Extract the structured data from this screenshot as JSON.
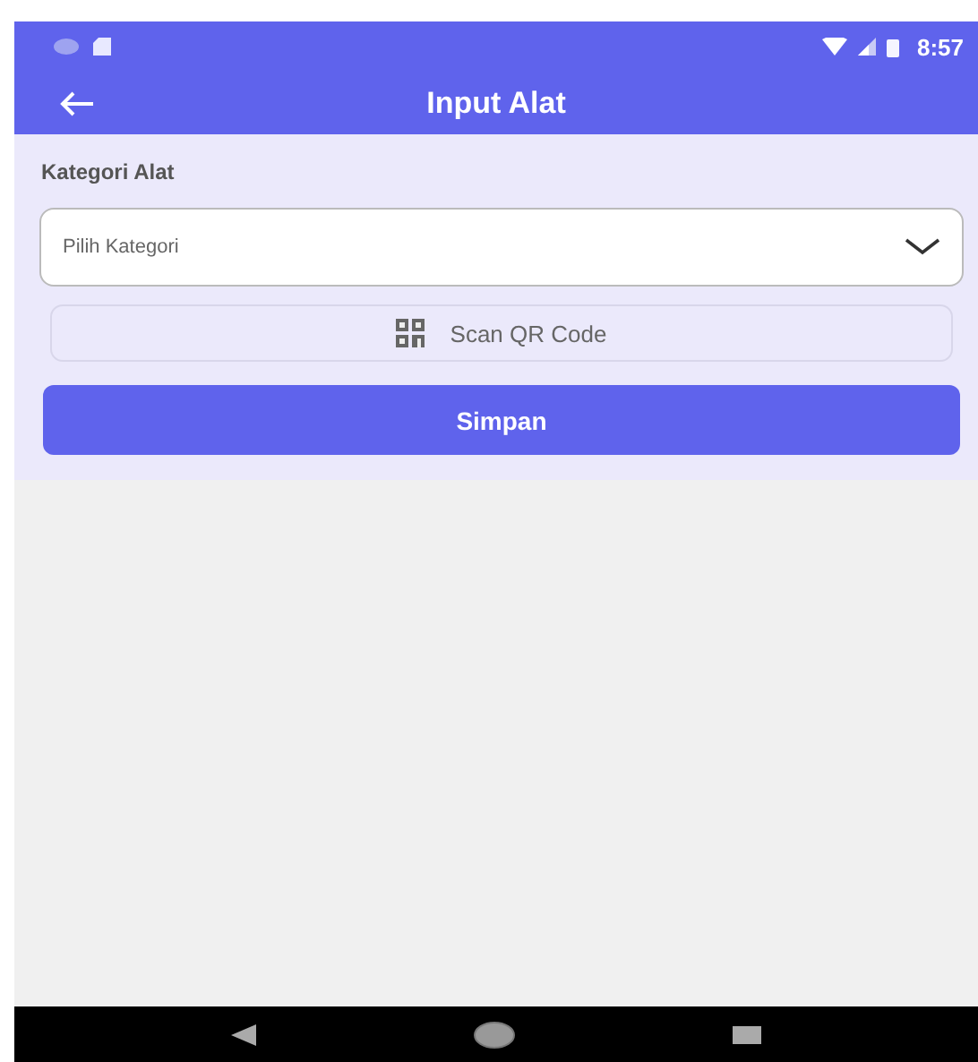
{
  "status_bar": {
    "time": "8:57"
  },
  "app_bar": {
    "title": "Input Alat"
  },
  "form": {
    "label": "Kategori Alat",
    "select": {
      "placeholder": "Pilih Kategori"
    },
    "scan_button": "Scan QR Code",
    "save_button": "Simpan"
  }
}
